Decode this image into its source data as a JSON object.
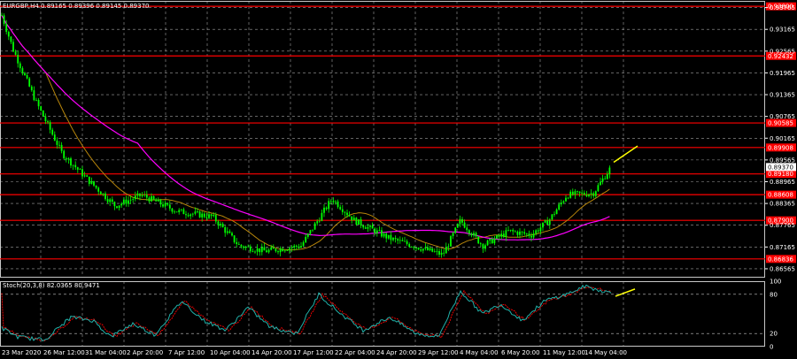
{
  "chart_data": [
    {
      "type": "candlestick",
      "title": "EURGBP,H4  0.89165 0.89396 0.89145 0.89370",
      "symbol": "EURGBP",
      "timeframe": "H4",
      "ohlc_last": {
        "open": 0.89165,
        "high": 0.89396,
        "low": 0.89145,
        "close": 0.8937
      },
      "current_price_label": "0.89370",
      "ylim": [
        0.8632,
        0.9395
      ],
      "y_ticks": [
        "0.93765",
        "0.93165",
        "0.92565",
        "0.91965",
        "0.91365",
        "0.90765",
        "0.90165",
        "0.89565",
        "0.88965",
        "0.88365",
        "0.87765",
        "0.87165",
        "0.86565"
      ],
      "x_ticks": [
        "23 Mar 2020",
        "26 Mar 12:00",
        "31 Mar 04:00",
        "2 Apr 20:00",
        "7 Apr 12:00",
        "10 Apr 04:00",
        "14 Apr 20:00",
        "17 Apr 12:00",
        "22 Apr 04:00",
        "24 Apr 20:00",
        "29 Apr 12:00",
        "4 May 04:00",
        "6 May 20:00",
        "11 May 12:00",
        "14 May 04:00"
      ],
      "grid": true,
      "colors": {
        "background": "#000000",
        "bull": "#00ff00",
        "bear": "#00ff00",
        "grid": "#c8c8c8",
        "level": "#ff0000",
        "ma_fast": "#b8860b",
        "ma_slow": "#ff00ff",
        "arrow": "#ffff00"
      },
      "horizontal_levels": [
        {
          "value": 0.938,
          "label": "0.93800"
        },
        {
          "value": 0.92432,
          "label": "0.92432"
        },
        {
          "value": 0.90585,
          "label": "0.90585"
        },
        {
          "value": 0.89908,
          "label": "0.89908"
        },
        {
          "value": 0.8918,
          "label": "0.89180"
        },
        {
          "value": 0.88608,
          "label": "0.88608"
        },
        {
          "value": 0.879,
          "label": "0.87900"
        },
        {
          "value": 0.86836,
          "label": "0.86836"
        }
      ],
      "trend_arrow": {
        "from": 0.895,
        "to": 0.8995
      }
    },
    {
      "type": "line",
      "title": "Stoch(20,3,8) 82.0365 80.9471",
      "indicator": "Stoch(20,3,8)",
      "main_value": "82.0365",
      "signal_value": "80.9471",
      "ylim": [
        0,
        100
      ],
      "y_ticks": [
        "100",
        "80",
        "20",
        "0"
      ],
      "colors": {
        "main": "#20b2aa",
        "signal": "#ff0000",
        "levels": "#c8c8c8"
      }
    }
  ]
}
